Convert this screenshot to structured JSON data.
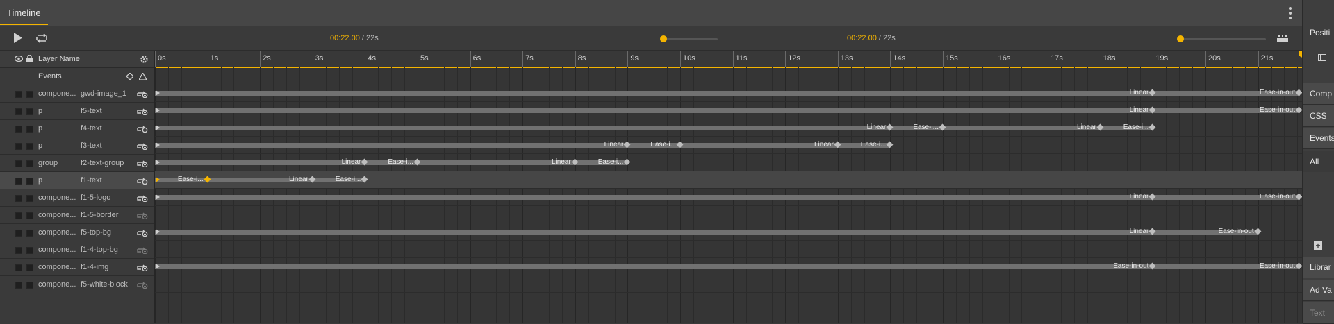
{
  "panel": {
    "title": "Timeline"
  },
  "controls": {
    "current_time": "00:22.00",
    "duration_sep": " / ",
    "duration": "22s",
    "current_time_2": "00:22.00",
    "duration_2": "22s"
  },
  "header": {
    "layer_name": "Layer Name",
    "events": "Events"
  },
  "ruler": {
    "ticks": [
      "0s",
      "1s",
      "2s",
      "3s",
      "4s",
      "5s",
      "6s",
      "7s",
      "8s",
      "9s",
      "10s",
      "11s",
      "12s",
      "13s",
      "14s",
      "15s",
      "16s",
      "17s",
      "18s",
      "19s",
      "20s",
      "21s"
    ]
  },
  "layers": [
    {
      "type": "compone...",
      "name": "gwd-image_1",
      "bar": [
        0,
        22
      ],
      "kfs": [
        {
          "t": 19,
          "label": "Linear"
        },
        {
          "t": 22,
          "label": "Ease-in-out"
        }
      ]
    },
    {
      "type": "p",
      "name": "f5-text",
      "bar": [
        0,
        22
      ],
      "kfs": [
        {
          "t": 19,
          "label": "Linear"
        },
        {
          "t": 22,
          "label": "Ease-in-out"
        }
      ]
    },
    {
      "type": "p",
      "name": "f4-text",
      "bar": [
        0,
        19
      ],
      "kfs": [
        {
          "t": 14,
          "label": "Linear"
        },
        {
          "t": 15,
          "label": "Ease-i..."
        },
        {
          "t": 18,
          "label": "Linear"
        },
        {
          "t": 19,
          "label": "Ease-i..."
        }
      ]
    },
    {
      "type": "p",
      "name": "f3-text",
      "bar": [
        0,
        14
      ],
      "kfs": [
        {
          "t": 9,
          "label": "Linear"
        },
        {
          "t": 10,
          "label": "Ease-i..."
        },
        {
          "t": 13,
          "label": "Linear"
        },
        {
          "t": 14,
          "label": "Ease-i..."
        }
      ]
    },
    {
      "type": "group",
      "name": "f2-text-group",
      "bar": [
        0,
        9
      ],
      "kfs": [
        {
          "t": 4,
          "label": "Linear"
        },
        {
          "t": 5,
          "label": "Ease-i..."
        },
        {
          "t": 8,
          "label": "Linear"
        },
        {
          "t": 9,
          "label": "Ease-i..."
        }
      ]
    },
    {
      "type": "p",
      "name": "f1-text",
      "bar": [
        0,
        4
      ],
      "selected": true,
      "kfs": [
        {
          "t": 1,
          "label": "Ease-i...",
          "hl": true
        },
        {
          "t": 3,
          "label": "Linear"
        },
        {
          "t": 4,
          "label": "Ease-i..."
        }
      ]
    },
    {
      "type": "compone...",
      "name": "f1-5-logo",
      "bar": [
        0,
        22
      ],
      "kfs": [
        {
          "t": 19,
          "label": "Linear"
        },
        {
          "t": 22,
          "label": "Ease-in-out"
        }
      ]
    },
    {
      "type": "compone...",
      "name": "f1-5-border",
      "bar": null,
      "kfs": []
    },
    {
      "type": "compone...",
      "name": "f5-top-bg",
      "bar": [
        0,
        21
      ],
      "kfs": [
        {
          "t": 19,
          "label": "Linear"
        },
        {
          "t": 21,
          "label": "Ease-in-out"
        }
      ]
    },
    {
      "type": "compone...",
      "name": "f1-4-top-bg",
      "bar": null,
      "kfs": []
    },
    {
      "type": "compone...",
      "name": "f1-4-img",
      "bar": [
        0,
        22
      ],
      "kfs": [
        {
          "t": 19,
          "label": "Ease-in-out"
        },
        {
          "t": 22,
          "label": "Ease-in-out"
        }
      ]
    },
    {
      "type": "compone...",
      "name": "f5-white-block",
      "bar": null,
      "kfs": []
    }
  ],
  "side": {
    "items": [
      "Positi",
      "Comp",
      "CSS",
      "Events",
      "All",
      "Librar",
      "Ad Va",
      "Text"
    ]
  },
  "colors": {
    "accent": "#f4b400"
  }
}
